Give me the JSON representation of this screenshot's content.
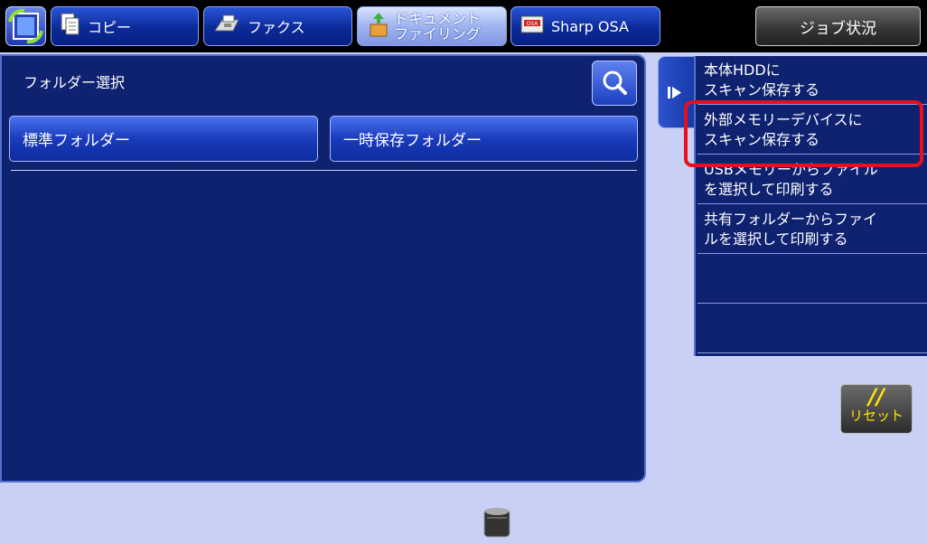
{
  "header": {
    "tabs": [
      {
        "label": "コピー",
        "icon": "copy-icon"
      },
      {
        "label": "ファクス",
        "icon": "fax-icon"
      },
      {
        "label_line1": "ドキュメント",
        "label_line2": "ファイリング",
        "icon": "document-filing-icon",
        "active": true
      },
      {
        "label": "Sharp OSA",
        "icon": "osa-icon"
      }
    ],
    "job_status": "ジョブ状況"
  },
  "main": {
    "title": "フォルダー選択",
    "folders": [
      "標準フォルダー",
      "一時保存フォルダー"
    ]
  },
  "side_menu": {
    "items": [
      {
        "line1": "本体HDDに",
        "line2": "スキャン保存する"
      },
      {
        "line1": "外部メモリーデバイスに",
        "line2": "スキャン保存する",
        "highlighted": true
      },
      {
        "line1": "USBメモリーからファイル",
        "line2": "を選択して印刷する"
      },
      {
        "line1": "共有フォルダーからファイ",
        "line2": "ルを選択して印刷する"
      },
      {
        "line1": "",
        "line2": ""
      },
      {
        "line1": "",
        "line2": ""
      }
    ]
  },
  "reset": {
    "symbol": "//",
    "label": "リセット"
  },
  "colors": {
    "panel_bg": "#0f2270",
    "page_bg": "#c8d0f5",
    "highlight": "#e8101a",
    "reset_text": "#ffe300"
  }
}
